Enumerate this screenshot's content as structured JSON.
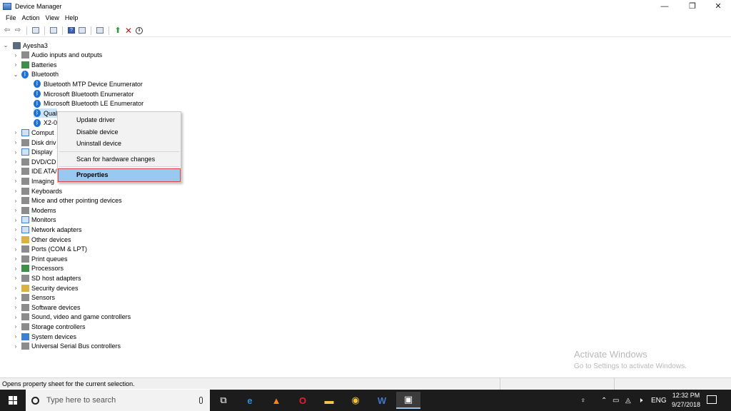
{
  "window": {
    "title": "Device Manager"
  },
  "menu": [
    "File",
    "Action",
    "View",
    "Help"
  ],
  "tree": {
    "root": "Ayesha3",
    "categories": [
      {
        "label": "Audio inputs and outputs",
        "icon": "speaker-icon"
      },
      {
        "label": "Batteries",
        "icon": "battery-icon"
      },
      {
        "label": "Bluetooth",
        "icon": "bluetooth-icon",
        "expanded": true,
        "children": [
          "Bluetooth MTP Device Enumerator",
          "Microsoft Bluetooth Enumerator",
          "Microsoft Bluetooth LE Enumerator",
          "Qual",
          "X2-0"
        ]
      },
      {
        "label": "Comput",
        "icon": "computer-icon"
      },
      {
        "label": "Disk driv",
        "icon": "disk-icon"
      },
      {
        "label": "Display",
        "icon": "display-icon"
      },
      {
        "label": "DVD/CD",
        "icon": "dvd-icon"
      },
      {
        "label": "IDE ATA/",
        "icon": "ide-icon"
      },
      {
        "label": "Imaging",
        "icon": "camera-icon"
      },
      {
        "label": "Keyboards",
        "icon": "keyboard-icon"
      },
      {
        "label": "Mice and other pointing devices",
        "icon": "mouse-icon"
      },
      {
        "label": "Modems",
        "icon": "modem-icon"
      },
      {
        "label": "Monitors",
        "icon": "monitor-icon"
      },
      {
        "label": "Network adapters",
        "icon": "network-icon"
      },
      {
        "label": "Other devices",
        "icon": "other-device-icon"
      },
      {
        "label": "Ports (COM & LPT)",
        "icon": "port-icon"
      },
      {
        "label": "Print queues",
        "icon": "printer-icon"
      },
      {
        "label": "Processors",
        "icon": "processor-icon"
      },
      {
        "label": "SD host adapters",
        "icon": "sd-icon"
      },
      {
        "label": "Security devices",
        "icon": "security-icon"
      },
      {
        "label": "Sensors",
        "icon": "sensor-icon"
      },
      {
        "label": "Software devices",
        "icon": "software-icon"
      },
      {
        "label": "Sound, video and game controllers",
        "icon": "sound-icon"
      },
      {
        "label": "Storage controllers",
        "icon": "storage-icon"
      },
      {
        "label": "System devices",
        "icon": "system-icon"
      },
      {
        "label": "Universal Serial Bus controllers",
        "icon": "usb-icon"
      }
    ]
  },
  "context_menu": {
    "update": "Update driver",
    "disable": "Disable device",
    "uninstall": "Uninstall device",
    "scan": "Scan for hardware changes",
    "properties": "Properties"
  },
  "watermark": {
    "line1": "Activate Windows",
    "line2": "Go to Settings to activate Windows."
  },
  "status": {
    "text": "Opens property sheet for the current selection."
  },
  "taskbar": {
    "search_placeholder": "Type here to search",
    "tray_lang": "ENG",
    "time": "12:32 PM",
    "date": "9/27/2018"
  }
}
